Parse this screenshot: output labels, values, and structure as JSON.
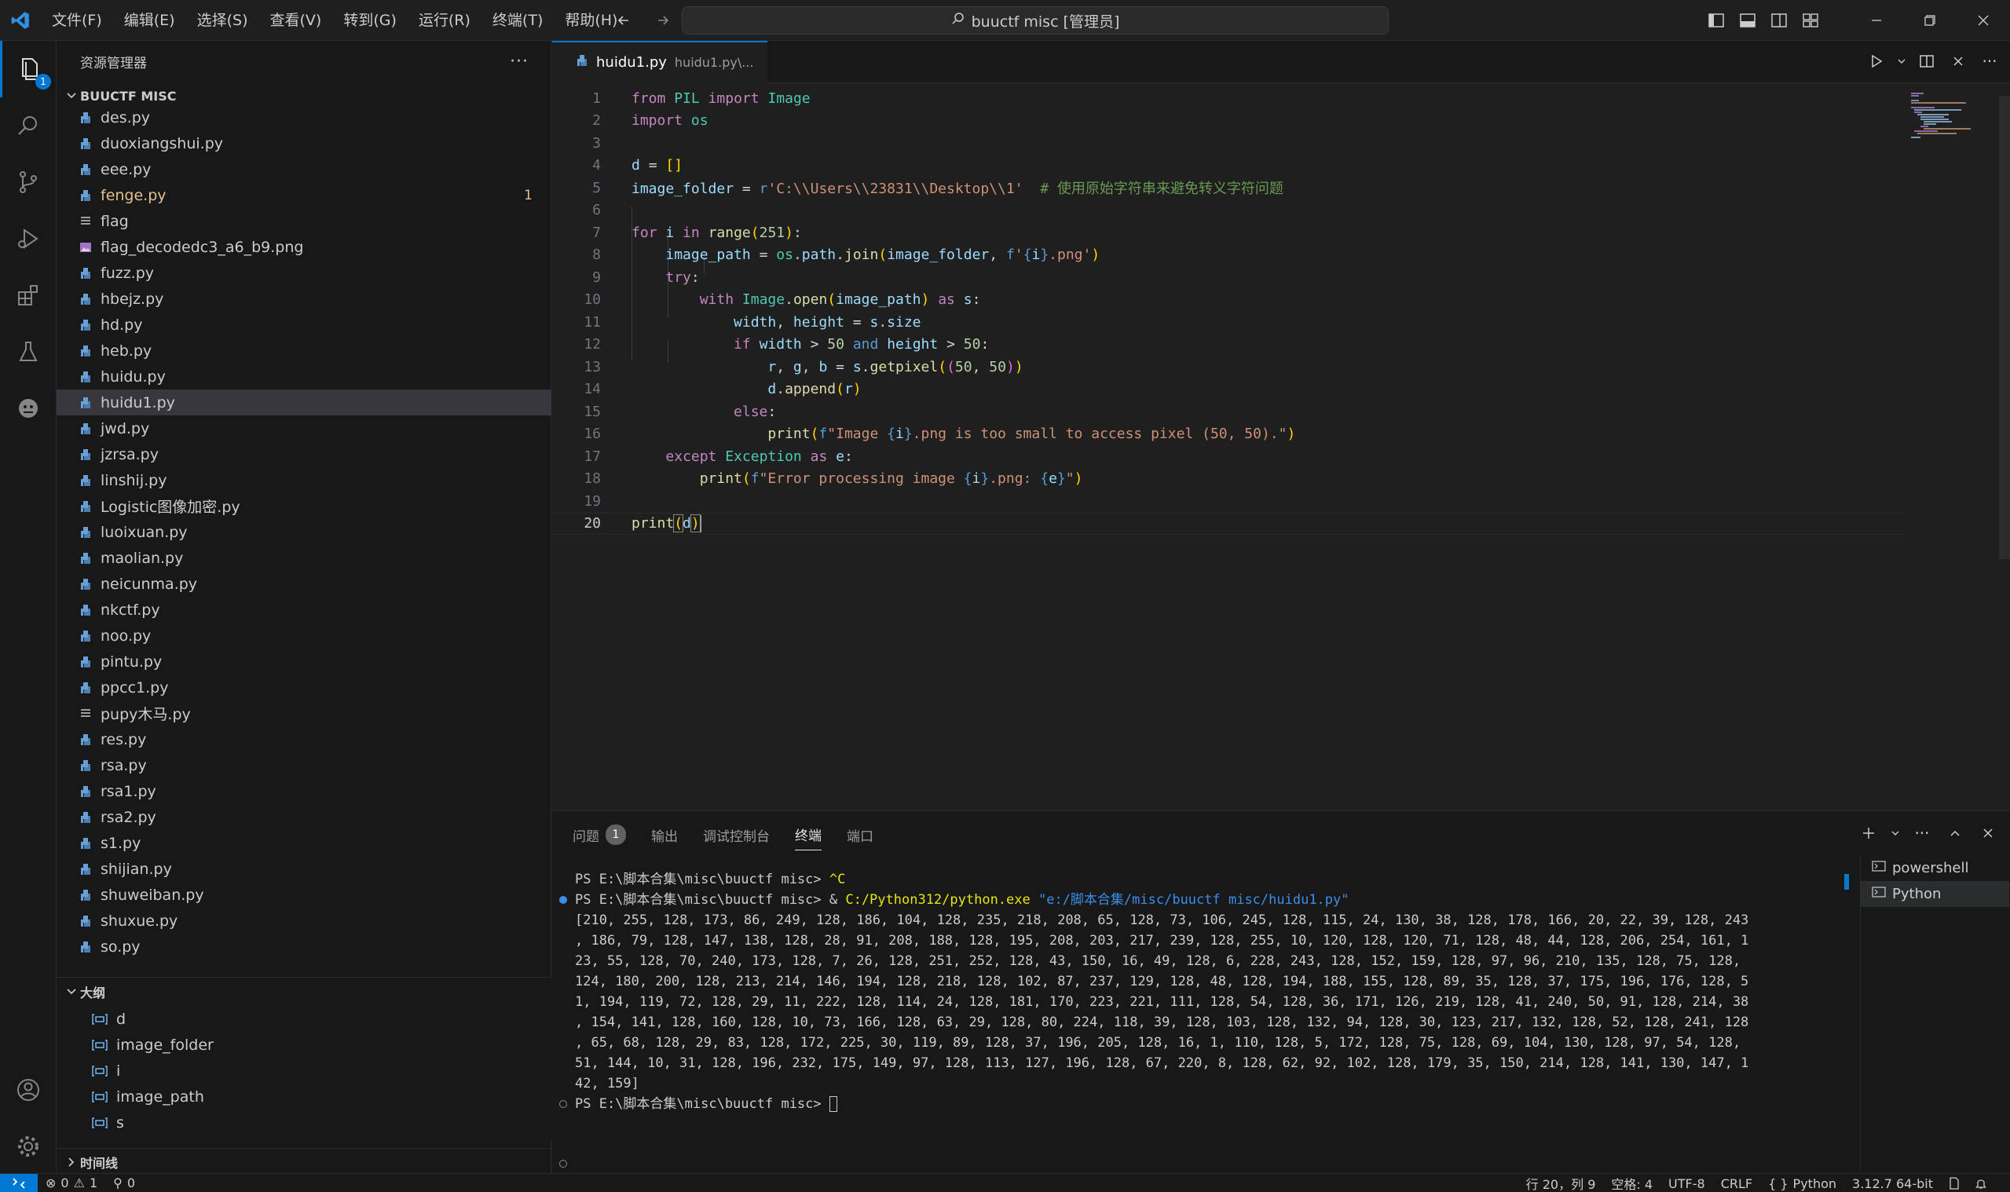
{
  "titlebar": {
    "menu": [
      "文件(F)",
      "编辑(E)",
      "选择(S)",
      "查看(V)",
      "转到(G)",
      "运行(R)",
      "终端(T)",
      "帮助(H)"
    ],
    "command_center": "buuctf misc [管理员]"
  },
  "activity": {
    "explorer_badge": "1"
  },
  "sidebar": {
    "title": "资源管理器",
    "root_folder": "BUUCTF MISC",
    "files": [
      {
        "name": "des.py",
        "type": "py"
      },
      {
        "name": "duoxiangshui.py",
        "type": "py"
      },
      {
        "name": "eee.py",
        "type": "py"
      },
      {
        "name": "fenge.py",
        "type": "py",
        "modified": true,
        "badge": "1"
      },
      {
        "name": "flag",
        "type": "text"
      },
      {
        "name": "flag_decodedc3_a6_b9.png",
        "type": "image"
      },
      {
        "name": "fuzz.py",
        "type": "py"
      },
      {
        "name": "hbejz.py",
        "type": "py"
      },
      {
        "name": "hd.py",
        "type": "py"
      },
      {
        "name": "heb.py",
        "type": "py"
      },
      {
        "name": "huidu.py",
        "type": "py"
      },
      {
        "name": "huidu1.py",
        "type": "py",
        "selected": true
      },
      {
        "name": "jwd.py",
        "type": "py"
      },
      {
        "name": "jzrsa.py",
        "type": "py"
      },
      {
        "name": "linshij.py",
        "type": "py"
      },
      {
        "name": "Logistic图像加密.py",
        "type": "py"
      },
      {
        "name": "luoixuan.py",
        "type": "py"
      },
      {
        "name": "maolian.py",
        "type": "py"
      },
      {
        "name": "neicunma.py",
        "type": "py"
      },
      {
        "name": "nkctf.py",
        "type": "py"
      },
      {
        "name": "noo.py",
        "type": "py"
      },
      {
        "name": "pintu.py",
        "type": "py"
      },
      {
        "name": "ppcc1.py",
        "type": "py"
      },
      {
        "name": "pupy木马.py",
        "type": "text"
      },
      {
        "name": "res.py",
        "type": "py"
      },
      {
        "name": "rsa.py",
        "type": "py"
      },
      {
        "name": "rsa1.py",
        "type": "py"
      },
      {
        "name": "rsa2.py",
        "type": "py"
      },
      {
        "name": "s1.py",
        "type": "py"
      },
      {
        "name": "shijian.py",
        "type": "py"
      },
      {
        "name": "shuweiban.py",
        "type": "py"
      },
      {
        "name": "shuxue.py",
        "type": "py"
      },
      {
        "name": "so.py",
        "type": "py"
      }
    ],
    "outline_title": "大纲",
    "outline": [
      "d",
      "image_folder",
      "i",
      "image_path",
      "s"
    ],
    "timeline_title": "时间线"
  },
  "editor": {
    "tab_name": "huidu1.py",
    "tab_path": "huidu1.py\\...",
    "cursor_line": 20,
    "line_numbers": [
      "1",
      "2",
      "3",
      "4",
      "5",
      "6",
      "7",
      "8",
      "9",
      "10",
      "11",
      "12",
      "13",
      "14",
      "15",
      "16",
      "17",
      "18",
      "19",
      "20"
    ]
  },
  "panel": {
    "tabs": [
      "问题",
      "输出",
      "调试控制台",
      "终端",
      "端口"
    ],
    "problems_count": "1",
    "terminal": {
      "line1": "PS E:\\脚本合集\\misc\\buuctf misc> ",
      "line1_ctrl": "^C",
      "line2_prompt": "PS E:\\脚本合集\\misc\\buuctf misc> & ",
      "line2_exe": "C:/Python312/python.exe",
      "line2_arg": " \"e:/脚本合集/misc/buuctf misc/huidu1.py\"",
      "output": [
        "[210, 255, 128, 173, 86, 249, 128, 186, 104, 128, 235, 218, 208, 65, 128, 73, 106, 245, 128, 115, 24, 130, 38, 128, 178, 166, 20, 22, 39, 128, 243",
        ", 186, 79, 128, 147, 138, 128, 28, 91, 208, 188, 128, 195, 208, 203, 217, 239, 128, 255, 10, 120, 128, 120, 71, 128, 48, 44, 128, 206, 254, 161, 1",
        "23, 55, 128, 70, 240, 173, 128, 7, 26, 128, 251, 252, 128, 43, 150, 16, 49, 128, 6, 228, 243, 128, 152, 159, 128, 97, 96, 210, 135, 128, 75, 128,",
        "124, 180, 200, 128, 213, 214, 146, 194, 128, 218, 128, 102, 87, 237, 129, 128, 48, 128, 194, 188, 155, 128, 89, 35, 128, 37, 175, 196, 176, 128, 5",
        "1, 194, 119, 72, 128, 29, 11, 222, 128, 114, 24, 128, 181, 170, 223, 221, 111, 128, 54, 128, 36, 171, 126, 219, 128, 41, 240, 50, 91, 128, 214, 38",
        ", 154, 141, 128, 160, 128, 10, 73, 166, 128, 63, 29, 128, 80, 224, 118, 39, 128, 103, 128, 132, 94, 128, 30, 123, 217, 132, 128, 52, 128, 241, 128",
        ", 65, 68, 128, 29, 83, 128, 172, 225, 30, 119, 89, 128, 37, 196, 205, 128, 16, 1, 110, 128, 5, 172, 128, 75, 128, 69, 104, 130, 128, 97, 54, 128,",
        "51, 144, 10, 31, 128, 196, 232, 175, 149, 97, 128, 113, 127, 196, 128, 67, 220, 8, 128, 62, 92, 102, 128, 179, 35, 150, 214, 128, 141, 130, 147, 1",
        "42, 159]"
      ],
      "line_last": "PS E:\\脚本合集\\misc\\buuctf misc> "
    },
    "terminal_list": [
      "powershell",
      "Python"
    ]
  },
  "statusbar": {
    "errors": "0",
    "warnings": "1",
    "ports": "0",
    "position": "行 20，列 9",
    "spaces": "空格: 4",
    "encoding": "UTF-8",
    "eol": "CRLF",
    "language": "Python",
    "interpreter": "3.12.7 64-bit"
  }
}
